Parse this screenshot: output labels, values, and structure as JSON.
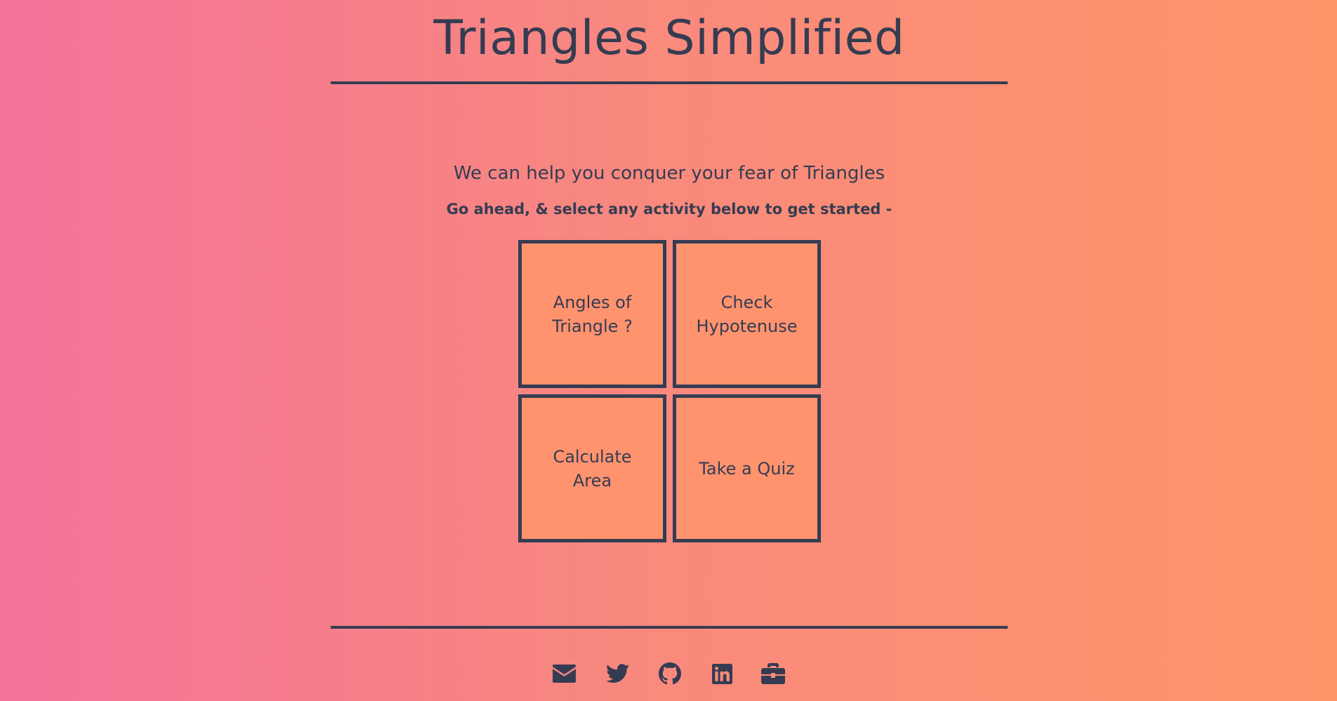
{
  "header": {
    "title": "Triangles Simplified"
  },
  "main": {
    "tagline": "We can help you conquer your fear of Triangles",
    "instruction": "Go ahead, & select any activity below to get started -",
    "activities": [
      {
        "label": "Angles of Triangle ?"
      },
      {
        "label": "Check Hypotenuse"
      },
      {
        "label": "Calculate Area"
      },
      {
        "label": "Take a Quiz"
      }
    ]
  },
  "footer": {
    "links": [
      {
        "icon": "envelope-icon"
      },
      {
        "icon": "twitter-icon"
      },
      {
        "icon": "github-icon"
      },
      {
        "icon": "linkedin-icon"
      },
      {
        "icon": "briefcase-icon"
      }
    ]
  },
  "colors": {
    "text": "#353c52",
    "tile": "#ff936e",
    "gradient_start": "#f3729a",
    "gradient_end": "#fe9468"
  }
}
